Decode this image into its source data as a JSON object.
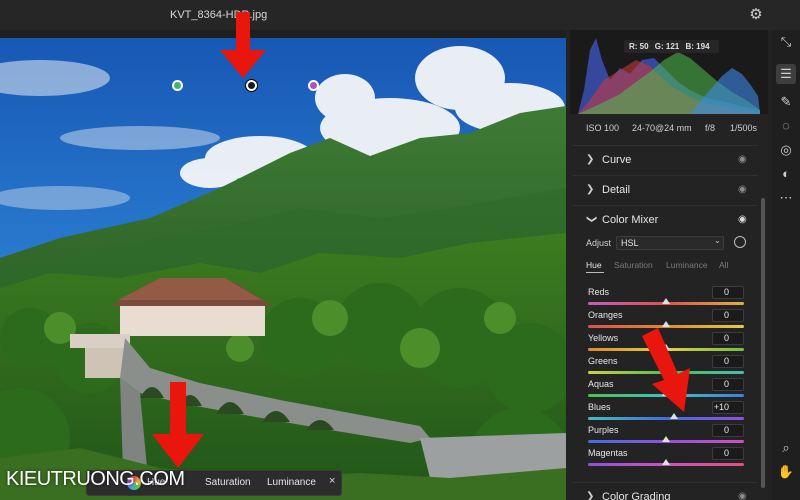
{
  "window": {
    "title": "KVT_8364-HDR.jpg"
  },
  "histogram": {
    "readout": {
      "r": "R: 50",
      "g": "G: 121",
      "b": "B: 194"
    },
    "exif": {
      "iso": "ISO 100",
      "lens": "24-70@24 mm",
      "aperture": "f/8",
      "shutter": "1/500s"
    }
  },
  "sections": {
    "curve": "Curve",
    "detail": "Detail",
    "color_mixer": "Color Mixer",
    "color_grading": "Color Grading"
  },
  "color_mixer": {
    "adjust_label": "Adjust",
    "adjust_value": "HSL",
    "tabs": [
      "Hue",
      "Saturation",
      "Luminance",
      "All"
    ],
    "active_tab": "Hue",
    "rows": [
      {
        "label": "Reds",
        "value": "0",
        "level": 0
      },
      {
        "label": "Oranges",
        "value": "0",
        "level": 0
      },
      {
        "label": "Yellows",
        "value": "0",
        "level": 0
      },
      {
        "label": "Greens",
        "value": "0",
        "level": 0
      },
      {
        "label": "Aquas",
        "value": "0",
        "level": 0
      },
      {
        "label": "Blues",
        "value": "+10",
        "level": 10
      },
      {
        "label": "Purples",
        "value": "0",
        "level": 0
      },
      {
        "label": "Magentas",
        "value": "0",
        "level": 0
      }
    ]
  },
  "photo_toolbar": {
    "items": [
      "Hue",
      "Saturation",
      "Luminance"
    ],
    "active": "Hue",
    "close": "×"
  },
  "watermark": "KIEUTRUONG.COM",
  "icons": {
    "settings": "gear-icon",
    "collapse": "collapse-icon",
    "edit": "sliders-icon",
    "heal": "bandage-icon",
    "mask": "mask-icon",
    "redeye": "eye-icon",
    "presets": "presets-icon",
    "more": "more-icon",
    "zoom": "zoom-icon",
    "hand": "hand-icon"
  },
  "colors": {
    "accent_arrow": "#e8160c",
    "panel_bg": "#232323",
    "sky_top": "#1a5bb8"
  }
}
